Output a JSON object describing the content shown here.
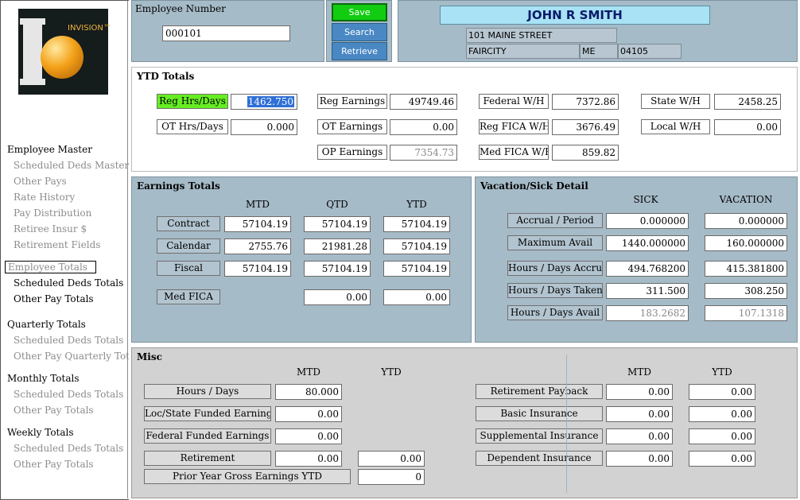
{
  "logo": {
    "text": "INVISION™"
  },
  "sidebar": {
    "employee_master": "Employee Master",
    "scheduled_deds_master": "Scheduled Deds Master",
    "other_pays": "Other Pays",
    "rate_history": "Rate History",
    "pay_distribution": "Pay Distribution",
    "retiree_insur": "Retiree Insur $",
    "retirement_fields": "Retirement Fields",
    "employee_totals": "Employee Totals",
    "scheduled_deds_totals": "Scheduled Deds Totals",
    "other_pay_totals": "Other Pay Totals",
    "quarterly_totals": "Quarterly Totals",
    "q_scheduled": "Scheduled Deds Totals",
    "q_otherpay": "Other Pay Quarterly Totals",
    "monthly_totals": "Monthly Totals",
    "m_scheduled": "Scheduled Deds Totals",
    "m_otherpay": "Other Pay Totals",
    "weekly_totals": "Weekly Totals",
    "w_scheduled": "Scheduled Deds Totals",
    "w_otherpay": "Other Pay Totals"
  },
  "header": {
    "employee_number_label": "Employee Number",
    "employee_number": "000101",
    "save": "Save",
    "search": "Search",
    "retrieve": "Retrieve",
    "name": "JOHN R SMITH",
    "street": "101 MAINE STREET",
    "city": "FAIRCITY",
    "state": "ME",
    "zip": "04105"
  },
  "ytd": {
    "title": "YTD Totals",
    "reg_hrs_label": "Reg Hrs/Days",
    "reg_hrs": "1462.750",
    "ot_hrs_label": "OT Hrs/Days",
    "ot_hrs": "0.000",
    "reg_earn_label": "Reg Earnings",
    "reg_earn": "49749.46",
    "ot_earn_label": "OT Earnings",
    "ot_earn": "0.00",
    "op_earn_label": "OP Earnings",
    "op_earn": "7354.73",
    "fed_wh_label": "Federal W/H",
    "fed_wh": "7372.86",
    "reg_fica_label": "Reg FICA W/H",
    "reg_fica": "3676.49",
    "med_fica_label": "Med FICA W/H",
    "med_fica": "859.82",
    "state_wh_label": "State W/H",
    "state_wh": "2458.25",
    "local_wh_label": "Local W/H",
    "local_wh": "0.00"
  },
  "earnings": {
    "title": "Earnings Totals",
    "mtd": "MTD",
    "qtd": "QTD",
    "ytd": "YTD",
    "contract_label": "Contract",
    "contract": [
      "57104.19",
      "57104.19",
      "57104.19"
    ],
    "calendar_label": "Calendar",
    "calendar": [
      "2755.76",
      "21981.28",
      "57104.19"
    ],
    "fiscal_label": "Fiscal",
    "fiscal": [
      "57104.19",
      "57104.19",
      "57104.19"
    ],
    "medfica_label": "Med FICA",
    "medfica": [
      "0.00",
      "0.00"
    ]
  },
  "vacation": {
    "title": "Vacation/Sick Detail",
    "sick": "SICK",
    "vacation": "VACATION",
    "accrual_label": "Accrual /  Period",
    "accrual": [
      "0.000000",
      "0.000000"
    ],
    "max_label": "Maximum Avail",
    "max": [
      "1440.000000",
      "160.000000"
    ],
    "accrued_label": "Hours / Days Accrued",
    "accrued": [
      "494.768200",
      "415.381800"
    ],
    "taken_label": "Hours / Days Taken",
    "taken": [
      "311.500",
      "308.250"
    ],
    "avail_label": "Hours / Days Avail",
    "avail": [
      "183.2682",
      "107.1318"
    ]
  },
  "misc": {
    "title": "Misc",
    "mtd": "MTD",
    "ytd": "YTD",
    "hours_label": "Hours / Days",
    "hours": "80.000",
    "locstate_label": "Loc/State Funded Earnings",
    "locstate": "0.00",
    "federal_label": "Federal Funded Earnings",
    "federal": "0.00",
    "retirement_label": "Retirement",
    "retirement": [
      "0.00",
      "0.00"
    ],
    "prior_label": "Prior Year Gross Earnings YTD",
    "prior": "0",
    "payback_label": "Retirement Payback",
    "payback": [
      "0.00",
      "0.00"
    ],
    "basic_label": "Basic Insurance",
    "basic": [
      "0.00",
      "0.00"
    ],
    "supp_label": "Supplemental Insurance",
    "supp": [
      "0.00",
      "0.00"
    ],
    "dep_label": "Dependent Insurance",
    "dep": [
      "0.00",
      "0.00"
    ]
  }
}
